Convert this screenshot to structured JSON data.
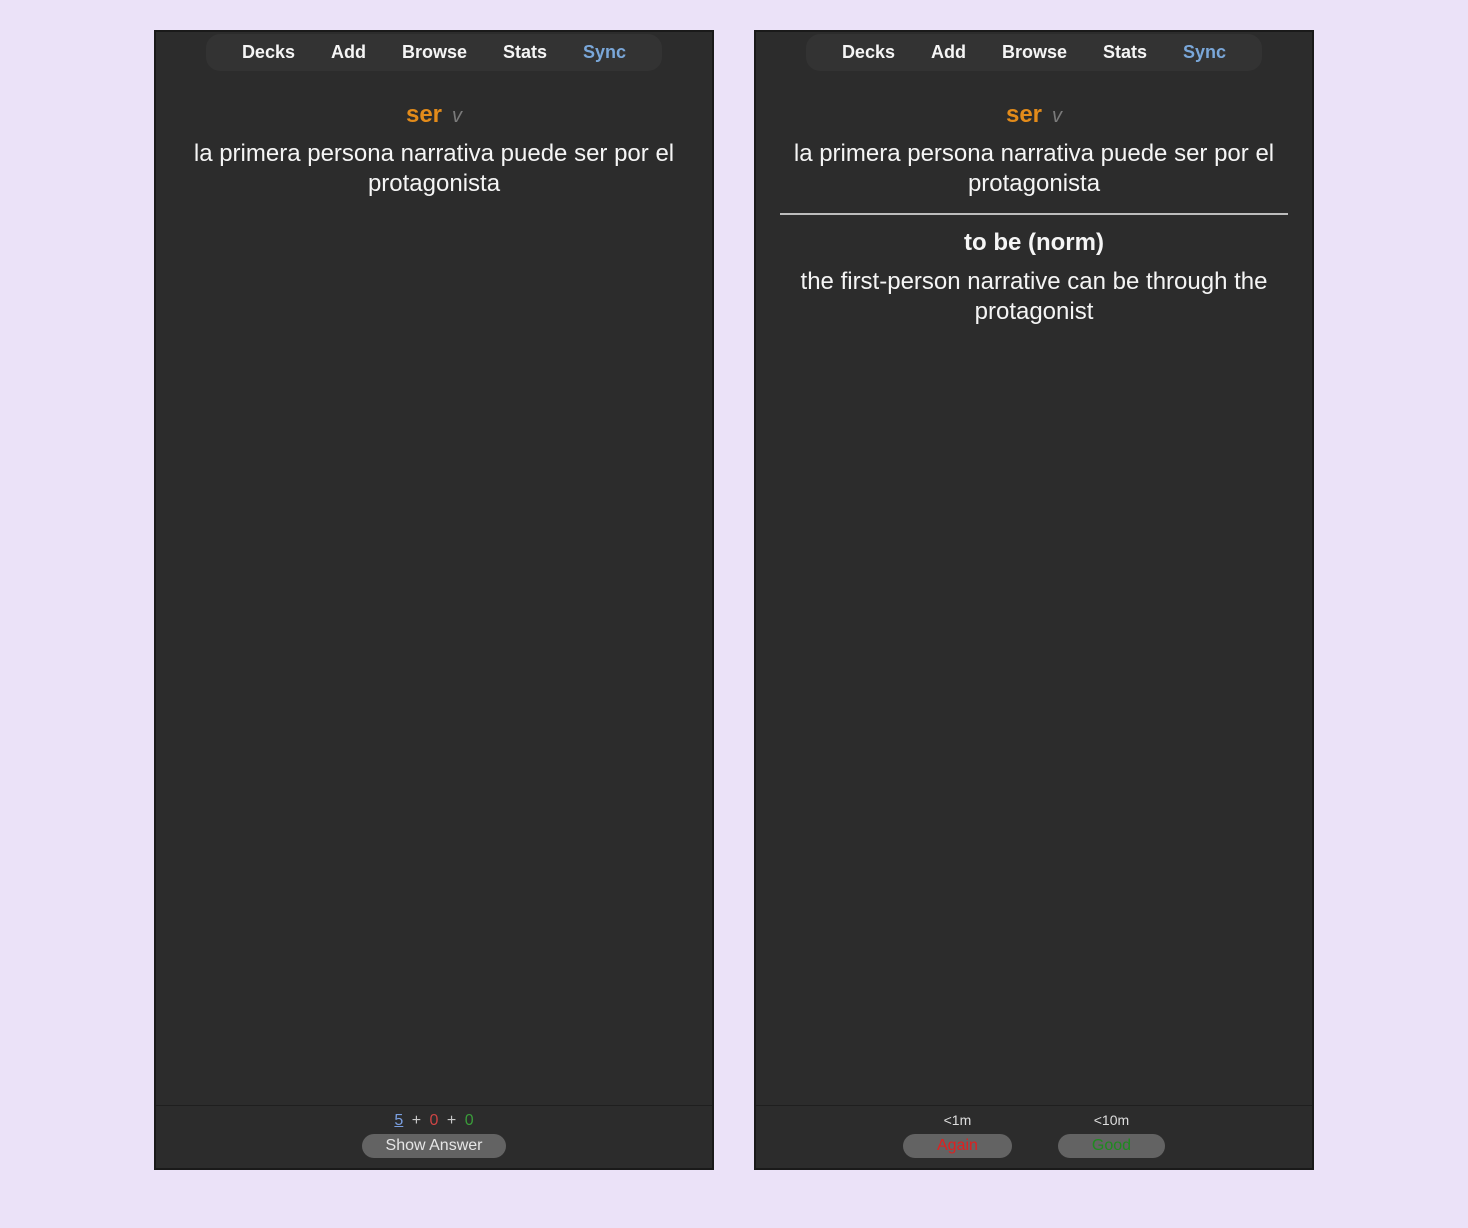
{
  "nav": {
    "decks": "Decks",
    "add": "Add",
    "browse": "Browse",
    "stats": "Stats",
    "sync": "Sync"
  },
  "card": {
    "headword": "ser",
    "pos": "v",
    "front_sentence": "la primera persona narrativa puede ser por el protagonista",
    "answer_head": "to be (norm)",
    "answer_sentence": "the first-person narrative can be through the protagonist"
  },
  "counts": {
    "new": "5",
    "learn": "0",
    "due": "0"
  },
  "buttons": {
    "show_answer": "Show Answer",
    "again": "Again",
    "good": "Good",
    "again_time": "<1m",
    "good_time": "<10m"
  }
}
